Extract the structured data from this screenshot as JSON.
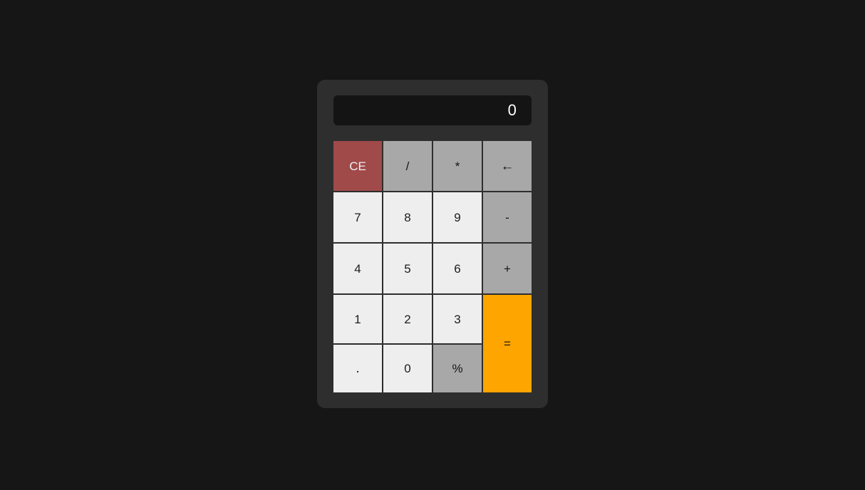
{
  "app": {
    "name": "Calculator",
    "background_color": "#161616",
    "panel_color": "#2e2e2e"
  },
  "display": {
    "value": "0",
    "placeholder": "0",
    "background_color": "#141414",
    "text_color": "#ffffff"
  },
  "colors": {
    "number_key": "#eeeeee",
    "operator_key": "#a8a8a8",
    "clear_key": "#a04a4a",
    "equals_key": "#ffa500",
    "key_text_dark": "#1b1b1b",
    "key_text_light": "#f2efef"
  },
  "keypad": {
    "rows": [
      [
        {
          "label": "CE",
          "name": "clear-entry-key",
          "kind": "clear"
        },
        {
          "label": "/",
          "name": "divide-key",
          "kind": "op"
        },
        {
          "label": "*",
          "name": "multiply-key",
          "kind": "op"
        },
        {
          "label": "←",
          "name": "backspace-icon",
          "kind": "op"
        }
      ],
      [
        {
          "label": "7",
          "name": "digit-7-key",
          "kind": "num"
        },
        {
          "label": "8",
          "name": "digit-8-key",
          "kind": "num"
        },
        {
          "label": "9",
          "name": "digit-9-key",
          "kind": "num"
        },
        {
          "label": "-",
          "name": "subtract-key",
          "kind": "op"
        }
      ],
      [
        {
          "label": "4",
          "name": "digit-4-key",
          "kind": "num"
        },
        {
          "label": "5",
          "name": "digit-5-key",
          "kind": "num"
        },
        {
          "label": "6",
          "name": "digit-6-key",
          "kind": "num"
        },
        {
          "label": "+",
          "name": "add-key",
          "kind": "op"
        }
      ],
      [
        {
          "label": "1",
          "name": "digit-1-key",
          "kind": "num"
        },
        {
          "label": "2",
          "name": "digit-2-key",
          "kind": "num"
        },
        {
          "label": "3",
          "name": "digit-3-key",
          "kind": "num"
        },
        {
          "label": "=",
          "name": "equals-key",
          "kind": "equals"
        }
      ],
      [
        {
          "label": ".",
          "name": "decimal-point-key",
          "kind": "num"
        },
        {
          "label": "0",
          "name": "digit-0-key",
          "kind": "num"
        },
        {
          "label": "%",
          "name": "percent-key",
          "kind": "op"
        }
      ]
    ]
  }
}
